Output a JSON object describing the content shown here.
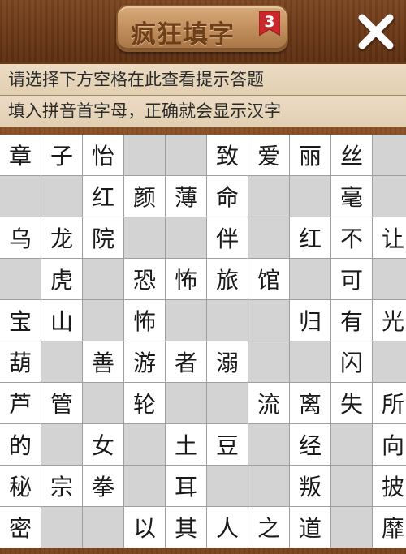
{
  "header": {
    "title": "疯狂填字",
    "level": "3",
    "close_icon": "close-x-icon"
  },
  "hints": {
    "line1": "请选择下方空格在此查看提示答题",
    "line2": "填入拼音首字母，正确就会显示汉字"
  },
  "colors": {
    "header_wood": "#6a3817",
    "badge_gold": "#c18f5d",
    "ribbon_red": "#c8282b",
    "hint_bg": "#e2cfb2",
    "cell_filled": "#ffffff",
    "cell_empty": "#d3d3d3"
  },
  "grid": [
    [
      "章",
      "子",
      "怡",
      "",
      "",
      "致",
      "爱",
      "丽",
      "丝",
      ""
    ],
    [
      "",
      "",
      "红",
      "颜",
      "薄",
      "命",
      "",
      "",
      "毫",
      ""
    ],
    [
      "乌",
      "龙",
      "院",
      "",
      "",
      "伴",
      "",
      "红",
      "不",
      "让"
    ],
    [
      "",
      "虎",
      "",
      "恐",
      "怖",
      "旅",
      "馆",
      "",
      "可",
      ""
    ],
    [
      "宝",
      "山",
      "",
      "怖",
      "",
      "",
      "",
      "归",
      "有",
      "光"
    ],
    [
      "葫",
      "",
      "善",
      "游",
      "者",
      "溺",
      "",
      "",
      "闪",
      ""
    ],
    [
      "芦",
      "管",
      "",
      "轮",
      "",
      "",
      "流",
      "离",
      "失",
      "所"
    ],
    [
      "的",
      "",
      "女",
      "",
      "土",
      "豆",
      "",
      "经",
      "",
      "向"
    ],
    [
      "秘",
      "宗",
      "拳",
      "",
      "耳",
      "",
      "",
      "叛",
      "",
      "披"
    ],
    [
      "密",
      "",
      "",
      "以",
      "其",
      "人",
      "之",
      "道",
      "",
      "靡"
    ]
  ]
}
